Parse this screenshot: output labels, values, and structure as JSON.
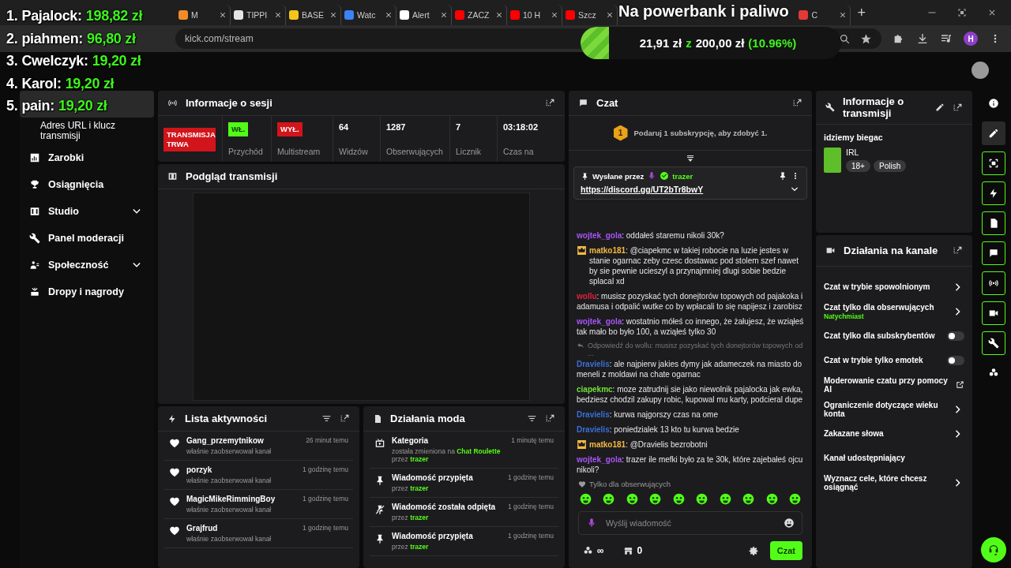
{
  "browser": {
    "tabs": [
      {
        "label": "M",
        "color": "#f28c28"
      },
      {
        "label": "TIPPI",
        "color": "#e5e5e5"
      },
      {
        "label": "BASE",
        "color": "#f5c518"
      },
      {
        "label": "Watc",
        "color": "#3b82f6"
      },
      {
        "label": "Alert",
        "color": "#ffffff"
      },
      {
        "label": "ZACZ",
        "color": "#ff0000"
      },
      {
        "label": "10 H",
        "color": "#ff0000"
      },
      {
        "label": "Szcz",
        "color": "#ff0000"
      },
      {
        "label": "C",
        "color": "#e53935"
      }
    ],
    "plus": "+",
    "address": "kick.com/stream",
    "profile": "H"
  },
  "sidebar": {
    "items": [
      {
        "kind": "main",
        "selected": true,
        "expandable": false
      },
      {
        "kind": "sub",
        "label": "Adres URL i klucz transmisji",
        "selected": false,
        "expandable": false
      },
      {
        "kind": "main",
        "label": "Zarobki",
        "selected": false,
        "expandable": false
      },
      {
        "kind": "main",
        "label": "Osiągnięcia",
        "selected": false,
        "expandable": false
      },
      {
        "kind": "main",
        "label": "Studio",
        "selected": false,
        "expandable": true
      },
      {
        "kind": "main",
        "label": "Panel moderacji",
        "selected": false,
        "expandable": false
      },
      {
        "kind": "main",
        "label": "Społeczność",
        "selected": false,
        "expandable": true
      },
      {
        "kind": "main",
        "label": "Dropy i nagrody",
        "selected": false,
        "expandable": false
      }
    ]
  },
  "session": {
    "title": "Informacje o sesji",
    "status": "TRANSMISJA TRWA",
    "stats": [
      {
        "kind": "toggle",
        "value": "WŁ.",
        "on": true,
        "label": "Przychód"
      },
      {
        "kind": "toggle",
        "value": "WYŁ.",
        "on": false,
        "label": "Multistream"
      },
      {
        "kind": "number",
        "value": "64",
        "label": "Widzów"
      },
      {
        "kind": "number",
        "value": "1287",
        "label": "Obserwujących"
      },
      {
        "kind": "number",
        "value": "7",
        "label": "Licznik"
      },
      {
        "kind": "number",
        "value": "03:18:02",
        "label": "Czas na"
      }
    ]
  },
  "preview": {
    "title": "Podgląd transmisji"
  },
  "activity": {
    "title": "Lista aktywności",
    "items": [
      {
        "name": "Gang_przemytnikow",
        "text": "właśnie zaobserwował kanał",
        "time": "26 minut temu"
      },
      {
        "name": "porzyk",
        "text": "właśnie zaobserwował kanał",
        "time": "1 godzinę temu"
      },
      {
        "name": "MagicMikeRimmingBoy",
        "text": "właśnie zaobserwował kanał",
        "time": "1 godzinę temu"
      },
      {
        "name": "Grajfrud",
        "text": "właśnie zaobserwował kanał",
        "time": "1 godzinę temu"
      }
    ]
  },
  "mod_actions": {
    "title": "Działania moda",
    "items": [
      {
        "kind": "category",
        "title": "Kategoria",
        "text": "została zmieniona na **Chat Roulette** przez **trazer**",
        "time": "1 minutę temu"
      },
      {
        "kind": "pin",
        "title": "Wiadomość przypięta",
        "text": "przez **trazer**",
        "time": "1 godzinę temu"
      },
      {
        "kind": "unpin",
        "title": "Wiadomość została odpięta",
        "text": "przez **trazer**",
        "time": "1 godzinę temu"
      },
      {
        "kind": "pin",
        "title": "Wiadomość przypięta",
        "text": "przez **trazer**",
        "time": "1 godzinę temu"
      }
    ]
  },
  "chat": {
    "title": "Czat",
    "gift_badge": "1",
    "gift_text": "Podaruj 1 subskrypcję, aby zdobyć 1.",
    "pinned": {
      "label": "Wysłane przez",
      "user": "trazer",
      "link": "https://discord.gg/UT2bTr8bwY"
    },
    "messages": [
      {
        "user": "wojtek_gola",
        "color": "#a855f7",
        "crown": false,
        "text": ": oddałeś staremu nikoli 30k?"
      },
      {
        "user": "matko181",
        "color": "#f5b942",
        "crown": true,
        "text": ": @ciapekmc w takiej robocie na luzie jestes w stanie ogarnac zeby czesc dostawac pod stolem szef nawet by sie pewnie ucieszyl a przynajmniej dlugi sobie bedzie splacal xd"
      },
      {
        "user": "wollu",
        "color": "#e0203a",
        "crown": false,
        "text": ": musisz pozyskać tych donejtorów topowych od pajakoka i adamusa i odpalić wutke co by wpłacali to się napijesz i zarobisz"
      },
      {
        "user": "wojtek_gola",
        "color": "#a855f7",
        "crown": false,
        "text": ": wostatnio mółeś co innego, że żałujesz, że wziąłeś tak mało bo było 100, a wziąłeś tylko 30"
      },
      {
        "user": "Dravielis",
        "color": "#3b6fd8",
        "crown": false,
        "reply": "Odpowiedź do wollu: musisz pozyskać tych donejtorów topowych od ...",
        "text": ": ale najpierw jakies dymy jak adameczek na miasto do meneli z moldawi na chate ogarnac"
      },
      {
        "user": "ciapekmc",
        "color": "#72e03a",
        "crown": false,
        "text": ": moze zatrudnij sie jako niewolnik pajalocka jak ewka, bedziesz chodzil zakupy robic, kupowal mu karty, podcieral dupe"
      },
      {
        "user": "Dravielis",
        "color": "#3b6fd8",
        "crown": false,
        "text": ": kurwa najgorszy czas na ome"
      },
      {
        "user": "Dravielis",
        "color": "#3b6fd8",
        "crown": false,
        "text": ": poniedzialek 13 kto tu kurwa bedzie"
      },
      {
        "user": "matko181",
        "color": "#f5b942",
        "crown": true,
        "text": ": @Dravielis bezrobotni"
      },
      {
        "user": "wojtek_gola",
        "color": "#a855f7",
        "crown": false,
        "text": ": trazer ile mefki było za te 30k, które zajebałeś ojcu nikoli?"
      }
    ],
    "mode": "Tylko dla obserwujących",
    "placeholder": "Wyślij wiadomość",
    "points": "∞",
    "store_count": "0",
    "send": "Czat"
  },
  "stream_info": {
    "title": "Informacje o transmisji",
    "stream_title": "idziemy biegac",
    "category": "IRL",
    "tags": [
      "18+",
      "Polish"
    ]
  },
  "channel_actions": {
    "title": "Działania na kanale",
    "items": [
      {
        "kind": "chevron",
        "label": "Czat w trybie spowolnionym"
      },
      {
        "kind": "chevron",
        "label": "Czat tylko dla obserwujących",
        "sub": "Natychmiast"
      },
      {
        "kind": "toggle",
        "label": "Czat tylko dla subskrybentów",
        "on": false
      },
      {
        "kind": "toggle",
        "label": "Czat w trybie tylko emotek",
        "on": false
      },
      {
        "kind": "external",
        "label": "Moderowanie czatu przy pomocy AI"
      },
      {
        "kind": "chevron",
        "label": "Ograniczenie dotyczące wieku konta"
      },
      {
        "kind": "chevron",
        "label": "Zakazane słowa"
      },
      {
        "kind": "plain",
        "label": "Kanał udostępniający"
      },
      {
        "kind": "chevron",
        "label": "Wyznacz cele, które chcesz osiągnąć"
      }
    ]
  },
  "rail": [
    {
      "selected": false
    },
    {
      "selected": false
    },
    {
      "selected": true
    },
    {
      "selected": true
    },
    {
      "selected": true
    },
    {
      "selected": true
    },
    {
      "selected": true
    },
    {
      "selected": true
    },
    {
      "selected": true
    },
    {
      "selected": false
    }
  ],
  "overlay": {
    "leaderboard": [
      {
        "rank": "1.",
        "name": "Pajalock:",
        "amount": "198,82 zł"
      },
      {
        "rank": "2.",
        "name": "piahmen:",
        "amount": "96,80 zł"
      },
      {
        "rank": "3.",
        "name": "Cwelczyk:",
        "amount": "19,20 zł"
      },
      {
        "rank": "4.",
        "name": "Karol:",
        "amount": "19,20 zł"
      },
      {
        "rank": "5.",
        "name": "pain:",
        "amount": "19,20 zł"
      }
    ],
    "goal_title": "Na powerbank i paliwo",
    "goal": {
      "raised": "21,91 zł",
      "separator": "z",
      "target": "200,00 zł",
      "percent": "(10.96%)",
      "level": 0.1096
    }
  }
}
